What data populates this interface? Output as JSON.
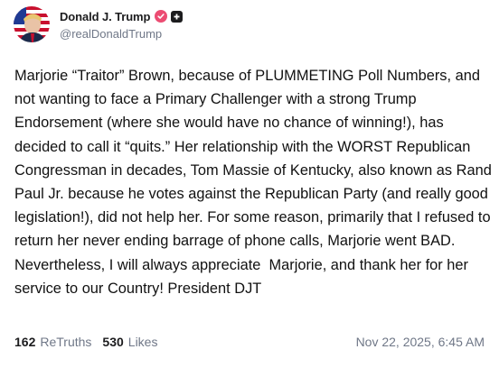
{
  "author": {
    "display_name": "Donald J. Trump",
    "handle": "@realDonaldTrump",
    "avatar_icon": "profile-photo-flag-background",
    "verified_icon": "verified-badge-icon",
    "verified_color": "#ec4c72",
    "affiliate_icon": "affiliate-badge-icon"
  },
  "post": {
    "text": "Marjorie “Traitor” Brown, because of PLUMMETING Poll Numbers, and not wanting to face a Primary Challenger with a strong Trump Endorsement (where she would have no chance of winning!), has decided to call it “quits.” Her relationship with the WORST Republican Congressman in decades, Tom Massie of Kentucky, also known as Rand Paul Jr. because he votes against the Republican Party (and really good legislation!), did not help her. For some reason, primarily that I refused to return her never ending barrage of phone calls, Marjorie went BAD. Nevertheless, I will always appreciate  Marjorie, and thank her for her service to our Country! President DJT"
  },
  "stats": {
    "retruths_count": "162",
    "retruths_label": "ReTruths",
    "likes_count": "530",
    "likes_label": "Likes"
  },
  "timestamp": "Nov 22, 2025, 6:45 AM"
}
